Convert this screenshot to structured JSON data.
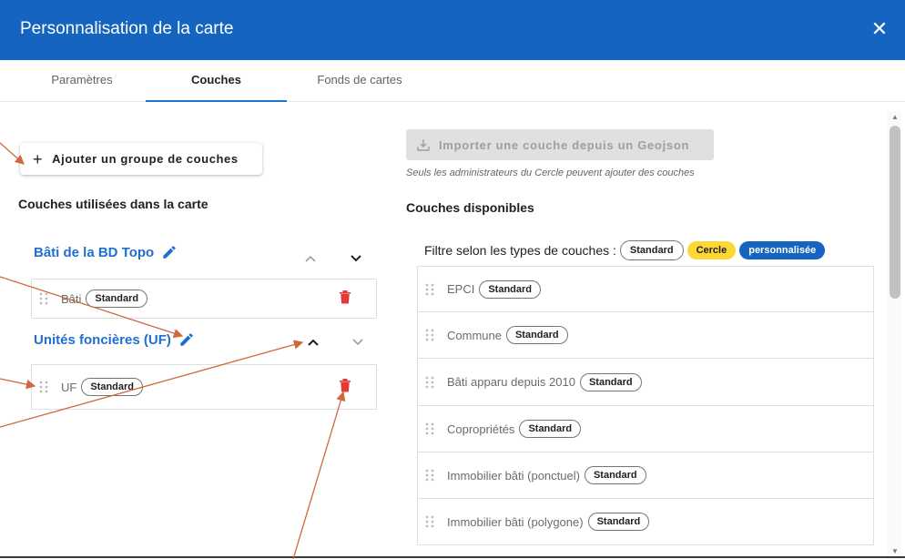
{
  "dialog": {
    "title": "Personnalisation de la carte",
    "close_icon": "close-icon"
  },
  "tabs": [
    {
      "label": "Paramètres",
      "active": false
    },
    {
      "label": "Couches",
      "active": true
    },
    {
      "label": "Fonds de cartes",
      "active": false
    }
  ],
  "left": {
    "add_group_label": "Ajouter un groupe de couches",
    "heading": "Couches utilisées dans la carte",
    "groups": [
      {
        "title": "Bâti de la BD Topo",
        "layers": [
          {
            "name": "Bâti",
            "type": "Standard"
          }
        ]
      },
      {
        "title": "Unités foncières (UF)",
        "layers": [
          {
            "name": "UF",
            "type": "Standard"
          }
        ]
      }
    ]
  },
  "right": {
    "import_label": "Importer une couche depuis un Geojson",
    "import_note": "Seuls les administrateurs du Cercle peuvent ajouter des couches",
    "heading": "Couches disponibles",
    "filter_label": "Filtre selon les types de couches :",
    "filter_chips": [
      "Standard",
      "Cercle",
      "personnalisée"
    ],
    "layers": [
      {
        "name": "EPCI",
        "type": "Standard"
      },
      {
        "name": "Commune",
        "type": "Standard"
      },
      {
        "name": "Bâti apparu depuis 2010",
        "type": "Standard"
      },
      {
        "name": "Copropriétés",
        "type": "Standard"
      },
      {
        "name": "Immobilier bâti (ponctuel)",
        "type": "Standard"
      },
      {
        "name": "Immobilier bâti (polygone)",
        "type": "Standard"
      }
    ]
  },
  "colors": {
    "header_bg": "#1565c0",
    "link_blue": "#1e6fd0",
    "delete_red": "#e53935",
    "cercle_chip": "#fdd835",
    "annotation_arrow": "#d2663e"
  }
}
